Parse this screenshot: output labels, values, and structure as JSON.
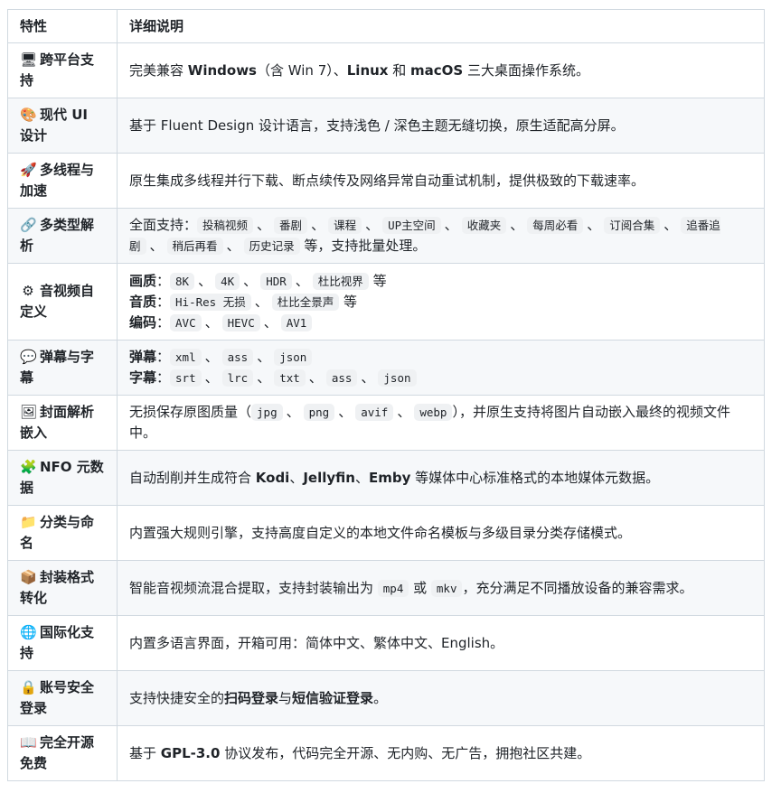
{
  "header": {
    "col1": "特性",
    "col2": "详细说明"
  },
  "rows": [
    {
      "feat": "跨平台支持",
      "icon": "🖥",
      "icon_name": "desktop-computer-icon",
      "d": [
        "完美兼容 ",
        "Windows",
        "（含 Win 7）、",
        "Linux",
        " 和 ",
        "macOS",
        " 三大桌面操作系统。"
      ]
    },
    {
      "feat": "现代 UI 设计",
      "icon": "🎨",
      "icon_name": "artist-palette-icon",
      "d": [
        "基于 Fluent Design 设计语言，支持浅色 / 深色主题无缝切换，原生适配高分屏。"
      ]
    },
    {
      "feat": "多线程与加速",
      "icon": "🚀",
      "icon_name": "rocket-icon",
      "d": [
        "原生集成多线程并行下载、断点续传及网络异常自动重试机制，提供极致的下载速率。"
      ]
    },
    {
      "feat": "多类型解析",
      "icon": "🔗",
      "icon_name": "link-icon",
      "d": [
        "全面支持：",
        "投稿视频",
        "番剧",
        "课程",
        "UP主空间",
        "收藏夹",
        "每周必看",
        "订阅合集",
        "追番追剧",
        "稍后再看",
        "历史记录",
        " 等，支持批量处理。"
      ]
    },
    {
      "feat": "音视频自定义",
      "icon": "⚙",
      "icon_name": "gear-icon",
      "d": [
        "画质",
        "：",
        "8K",
        "4K",
        "HDR",
        "杜比视界",
        " 等",
        "音质",
        "：",
        "Hi-Res 无损",
        "杜比全景声",
        " 等",
        "编码",
        "：",
        "AVC",
        "HEVC",
        "AV1"
      ]
    },
    {
      "feat": "弹幕与字幕",
      "icon": "💬",
      "icon_name": "speech-bubble-icon",
      "d": [
        "弹幕",
        "：",
        "xml",
        "ass",
        "json",
        "字幕",
        "：",
        "srt",
        "lrc",
        "txt",
        "ass",
        "json"
      ]
    },
    {
      "feat": "封面解析嵌入",
      "icon": "🖼",
      "icon_name": "framed-picture-icon",
      "d": [
        "无损保存原图质量（",
        "jpg",
        "png",
        "avif",
        "webp",
        "），并原生支持将图片自动嵌入最终的视频文件中。"
      ]
    },
    {
      "feat": "NFO 元数据",
      "icon": "🧩",
      "icon_name": "puzzle-piece-icon",
      "d": [
        "自动刮削并生成符合 ",
        "Kodi",
        "、",
        "Jellyfin",
        "、",
        "Emby",
        " 等媒体中心标准格式的本地媒体元数据。"
      ]
    },
    {
      "feat": "分类与命名",
      "icon": "📁",
      "icon_name": "folder-icon",
      "d": [
        "内置强大规则引擎，支持高度自定义的本地文件命名模板与多级目录分类存储模式。"
      ]
    },
    {
      "feat": "封装格式转化",
      "icon": "📦",
      "icon_name": "package-icon",
      "d": [
        "智能音视频流混合提取，支持封装输出为 ",
        "mp4",
        " 或 ",
        "mkv",
        "，充分满足不同播放设备的兼容需求。"
      ]
    },
    {
      "feat": "国际化支持",
      "icon": "🌐",
      "icon_name": "globe-icon",
      "d": [
        "内置多语言界面，开箱可用：简体中文、繁体中文、English。"
      ]
    },
    {
      "feat": "账号安全登录",
      "icon": "🔒",
      "icon_name": "lock-icon",
      "d": [
        "支持快捷安全的",
        "扫码登录",
        "与",
        "短信验证登录",
        "。"
      ]
    },
    {
      "feat": "完全开源免费",
      "icon": "📖",
      "icon_name": "open-book-icon",
      "d": [
        "基于 ",
        "GPL-3.0",
        " 协议发布，代码完全开源、无内购、无广告，拥抱社区共建。"
      ]
    }
  ],
  "separators": {
    "list": "、"
  }
}
